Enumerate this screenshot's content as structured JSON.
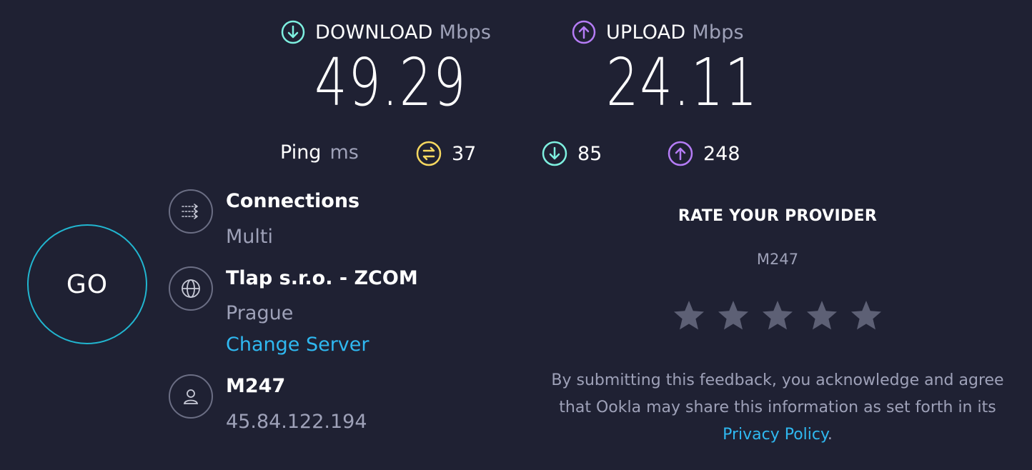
{
  "download": {
    "label": "DOWNLOAD",
    "unit": "Mbps",
    "value": "49.29",
    "icon": "arrow-down-circle-icon",
    "color": "#7ef0e0"
  },
  "upload": {
    "label": "UPLOAD",
    "unit": "Mbps",
    "value": "24.11",
    "icon": "arrow-up-circle-icon",
    "color": "#b57cf6"
  },
  "ping": {
    "label": "Ping",
    "unit": "ms",
    "idle": {
      "value": "37",
      "icon": "idle-latency-icon",
      "color": "#f6d860"
    },
    "download": {
      "value": "85",
      "icon": "arrow-down-circle-icon",
      "color": "#7ef0e0"
    },
    "upload": {
      "value": "248",
      "icon": "arrow-up-circle-icon",
      "color": "#b57cf6"
    }
  },
  "go_button": {
    "label": "GO",
    "color": "#21b6d0"
  },
  "connections": {
    "title": "Connections",
    "value": "Multi",
    "icon": "connections-icon"
  },
  "server": {
    "title": "Tlap s.r.o. - ZCOM",
    "location": "Prague",
    "change_label": "Change Server",
    "icon": "globe-icon"
  },
  "provider": {
    "title": "M247",
    "ip": "45.84.122.194",
    "icon": "user-icon"
  },
  "rating": {
    "title": "RATE YOUR PROVIDER",
    "provider": "M247",
    "stars": 5,
    "disclaimer": "By submitting this feedback, you acknowledge and agree that Ookla may share this information as set forth in its ",
    "privacy_label": "Privacy Policy",
    "period": "."
  },
  "colors": {
    "background": "#1f2133",
    "link": "#2fb8f0",
    "muted": "#9ea1b8"
  }
}
